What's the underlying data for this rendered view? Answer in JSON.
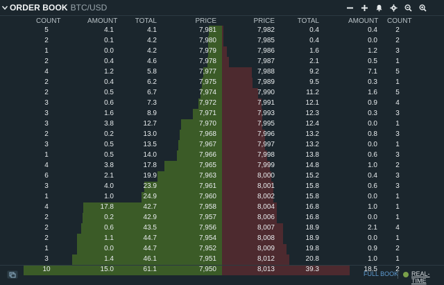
{
  "header": {
    "title": "ORDER BOOK",
    "pair": "BTC/USD",
    "icons": [
      "collapse-chevron-icon",
      "minus-icon",
      "plus-icon",
      "bell-icon",
      "gear-icon",
      "zoom-out-icon",
      "zoom-in-icon"
    ]
  },
  "columns": {
    "bids": [
      "COUNT",
      "AMOUNT",
      "TOTAL",
      "PRICE"
    ],
    "asks": [
      "PRICE",
      "TOTAL",
      "AMOUNT",
      "COUNT"
    ]
  },
  "colors": {
    "background": "#1b262d",
    "bid_depth": "#3b5b27",
    "ask_depth": "#4d2a2f",
    "link": "#5f9bd1",
    "realtime_dot": "#7aa04a"
  },
  "bids": [
    {
      "count": "5",
      "amount": "4.1",
      "total": "4.1",
      "price": "7,981"
    },
    {
      "count": "2",
      "amount": "0.1",
      "total": "4.2",
      "price": "7,980"
    },
    {
      "count": "1",
      "amount": "0.0",
      "total": "4.2",
      "price": "7,979"
    },
    {
      "count": "2",
      "amount": "0.4",
      "total": "4.6",
      "price": "7,978"
    },
    {
      "count": "4",
      "amount": "1.2",
      "total": "5.8",
      "price": "7,977"
    },
    {
      "count": "2",
      "amount": "0.4",
      "total": "6.2",
      "price": "7,975"
    },
    {
      "count": "2",
      "amount": "0.5",
      "total": "6.7",
      "price": "7,974"
    },
    {
      "count": "3",
      "amount": "0.6",
      "total": "7.3",
      "price": "7,972"
    },
    {
      "count": "3",
      "amount": "1.6",
      "total": "8.9",
      "price": "7,971"
    },
    {
      "count": "3",
      "amount": "3.8",
      "total": "12.7",
      "price": "7,970"
    },
    {
      "count": "2",
      "amount": "0.2",
      "total": "13.0",
      "price": "7,968"
    },
    {
      "count": "3",
      "amount": "0.5",
      "total": "13.5",
      "price": "7,967"
    },
    {
      "count": "1",
      "amount": "0.5",
      "total": "14.0",
      "price": "7,966"
    },
    {
      "count": "4",
      "amount": "3.8",
      "total": "17.8",
      "price": "7,965"
    },
    {
      "count": "6",
      "amount": "2.1",
      "total": "19.9",
      "price": "7,963"
    },
    {
      "count": "3",
      "amount": "4.0",
      "total": "23.9",
      "price": "7,961"
    },
    {
      "count": "1",
      "amount": "1.0",
      "total": "24.9",
      "price": "7,960"
    },
    {
      "count": "4",
      "amount": "17.8",
      "total": "42.7",
      "price": "7,958"
    },
    {
      "count": "2",
      "amount": "0.2",
      "total": "42.9",
      "price": "7,957"
    },
    {
      "count": "2",
      "amount": "0.6",
      "total": "43.5",
      "price": "7,956"
    },
    {
      "count": "2",
      "amount": "1.1",
      "total": "44.7",
      "price": "7,954"
    },
    {
      "count": "1",
      "amount": "0.0",
      "total": "44.7",
      "price": "7,952"
    },
    {
      "count": "3",
      "amount": "1.4",
      "total": "46.1",
      "price": "7,951"
    },
    {
      "count": "10",
      "amount": "15.0",
      "total": "61.1",
      "price": "7,950"
    }
  ],
  "asks": [
    {
      "price": "7,982",
      "total": "0.4",
      "amount": "0.4",
      "count": "2"
    },
    {
      "price": "7,985",
      "total": "0.4",
      "amount": "0.0",
      "count": "2"
    },
    {
      "price": "7,986",
      "total": "1.6",
      "amount": "1.2",
      "count": "3"
    },
    {
      "price": "7,987",
      "total": "2.1",
      "amount": "0.5",
      "count": "1"
    },
    {
      "price": "7,988",
      "total": "9.2",
      "amount": "7.1",
      "count": "5"
    },
    {
      "price": "7,989",
      "total": "9.5",
      "amount": "0.3",
      "count": "1"
    },
    {
      "price": "7,990",
      "total": "11.2",
      "amount": "1.6",
      "count": "5"
    },
    {
      "price": "7,991",
      "total": "12.1",
      "amount": "0.9",
      "count": "4"
    },
    {
      "price": "7,993",
      "total": "12.3",
      "amount": "0.3",
      "count": "3"
    },
    {
      "price": "7,995",
      "total": "12.4",
      "amount": "0.0",
      "count": "1"
    },
    {
      "price": "7,996",
      "total": "13.2",
      "amount": "0.8",
      "count": "3"
    },
    {
      "price": "7,997",
      "total": "13.2",
      "amount": "0.0",
      "count": "1"
    },
    {
      "price": "7,998",
      "total": "13.8",
      "amount": "0.6",
      "count": "3"
    },
    {
      "price": "7,999",
      "total": "14.8",
      "amount": "1.0",
      "count": "2"
    },
    {
      "price": "8,000",
      "total": "15.2",
      "amount": "0.4",
      "count": "3"
    },
    {
      "price": "8,001",
      "total": "15.8",
      "amount": "0.6",
      "count": "3"
    },
    {
      "price": "8,002",
      "total": "15.8",
      "amount": "0.0",
      "count": "1"
    },
    {
      "price": "8,004",
      "total": "16.8",
      "amount": "1.0",
      "count": "1"
    },
    {
      "price": "8,006",
      "total": "16.8",
      "amount": "0.0",
      "count": "1"
    },
    {
      "price": "8,007",
      "total": "18.9",
      "amount": "2.1",
      "count": "4"
    },
    {
      "price": "8,008",
      "total": "18.9",
      "amount": "0.0",
      "count": "1"
    },
    {
      "price": "8,009",
      "total": "19.8",
      "amount": "0.9",
      "count": "2"
    },
    {
      "price": "8,012",
      "total": "20.8",
      "amount": "1.0",
      "count": "1"
    },
    {
      "price": "8,013",
      "total": "39.3",
      "amount": "18.5",
      "count": "2"
    }
  ],
  "footer": {
    "full_book": "FULL BOOK",
    "realtime": "REAL-TIME",
    "icon": "popout-icon"
  }
}
